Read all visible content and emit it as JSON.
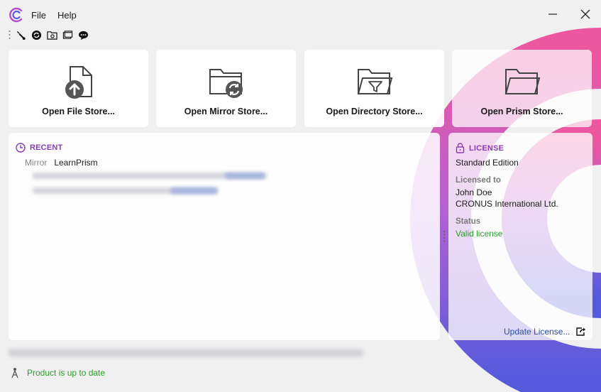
{
  "menu": {
    "file": "File",
    "help": "Help"
  },
  "toolbar": {
    "icons": [
      "wrench-icon",
      "refresh-icon",
      "folder-camera-icon",
      "windows-icon",
      "chat-icon"
    ]
  },
  "cards": {
    "file": {
      "label": "Open File Store..."
    },
    "mirror": {
      "label": "Open Mirror Store..."
    },
    "directory": {
      "label": "Open Directory Store..."
    },
    "prism": {
      "label": "Open Prism Store..."
    }
  },
  "recent": {
    "heading": "RECENT",
    "items": [
      {
        "kind": "Mirror",
        "name": "LearnPrism"
      }
    ]
  },
  "license": {
    "heading": "LICENSE",
    "edition": "Standard Edition",
    "licensed_to_label": "Licensed to",
    "licensee_name": "John Doe",
    "licensee_company": "CRONUS International Ltd.",
    "status_label": "Status",
    "status_value": "Valid license",
    "update_link": "Update License..."
  },
  "status_bar": {
    "message": "Product is up to date"
  },
  "colors": {
    "accent": "#8a3bb8",
    "success": "#2d9a2d",
    "link": "#2a4fa8",
    "arc_pink": "#e94aa0",
    "arc_violet": "#5a4ed8"
  }
}
